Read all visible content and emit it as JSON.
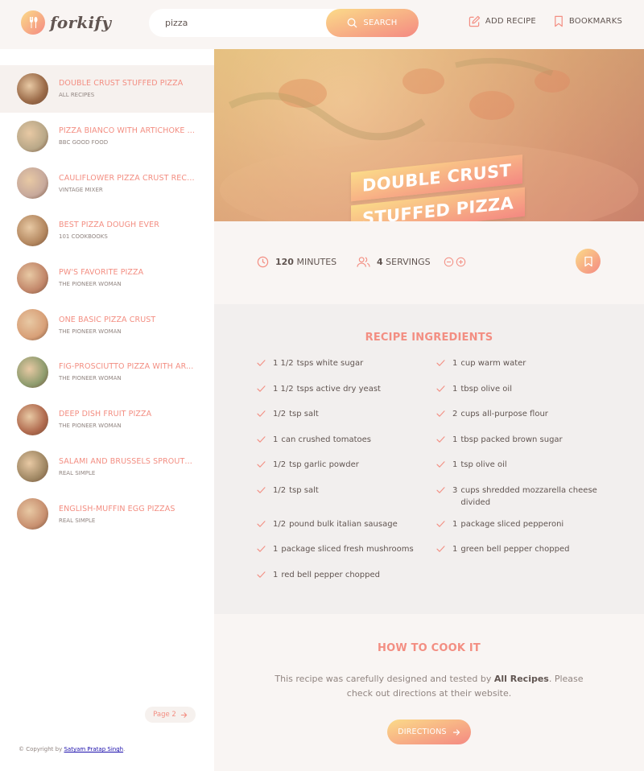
{
  "header": {
    "logo_text": "forkify",
    "search_value": "pizza",
    "search_button": "SEARCH",
    "nav": {
      "add_recipe": "ADD RECIPE",
      "bookmarks": "BOOKMARKS"
    }
  },
  "sidebar": {
    "results": [
      {
        "title": "DOUBLE CRUST STUFFED PIZZA",
        "publisher": "ALL RECIPES",
        "active": true,
        "thumb_color": "#9a6a48"
      },
      {
        "title": "PIZZA BIANCO WITH ARTICHOKE ...",
        "publisher": "BBC GOOD FOOD",
        "active": false,
        "thumb_color": "#b9a888"
      },
      {
        "title": "CAULIFLOWER PIZZA CRUST RECI...",
        "publisher": "VINTAGE MIXER",
        "active": false,
        "thumb_color": "#c7a99c"
      },
      {
        "title": "BEST PIZZA DOUGH EVER",
        "publisher": "101 COOKBOOKS",
        "active": false,
        "thumb_color": "#b48860"
      },
      {
        "title": "PW'S FAVORITE PIZZA",
        "publisher": "THE PIONEER WOMAN",
        "active": false,
        "thumb_color": "#c2876a"
      },
      {
        "title": "ONE BASIC PIZZA CRUST",
        "publisher": "THE PIONEER WOMAN",
        "active": false,
        "thumb_color": "#d8a078"
      },
      {
        "title": "FIG-PROSCIUTTO PIZZA WITH AR...",
        "publisher": "THE PIONEER WOMAN",
        "active": false,
        "thumb_color": "#8e9c6e"
      },
      {
        "title": "DEEP DISH FRUIT PIZZA",
        "publisher": "THE PIONEER WOMAN",
        "active": false,
        "thumb_color": "#b06a4e"
      },
      {
        "title": "SALAMI AND BRUSSELS SPROUTS...",
        "publisher": "REAL SIMPLE",
        "active": false,
        "thumb_color": "#a08864"
      },
      {
        "title": "ENGLISH-MUFFIN EGG PIZZAS",
        "publisher": "REAL SIMPLE",
        "active": false,
        "thumb_color": "#c89070"
      }
    ],
    "pagination": {
      "next_label": "Page 2"
    },
    "copyright": {
      "prefix": "© Copyright by ",
      "author": "Satyam Pratap Singh",
      "suffix": "."
    }
  },
  "recipe": {
    "title_line1": "DOUBLE CRUST",
    "title_line2": "STUFFED PIZZA",
    "cooking_time": "120",
    "cooking_time_unit": "MINUTES",
    "servings": "4",
    "servings_unit": "SERVINGS",
    "ingredients_heading": "RECIPE INGREDIENTS",
    "ingredients": [
      {
        "qty": "1 1/2",
        "desc": "tsps white sugar"
      },
      {
        "qty": "1",
        "desc": "cup warm water"
      },
      {
        "qty": "1 1/2",
        "desc": "tsps active dry yeast"
      },
      {
        "qty": "1",
        "desc": "tbsp olive oil"
      },
      {
        "qty": "1/2",
        "desc": "tsp salt"
      },
      {
        "qty": "2",
        "desc": "cups all-purpose flour"
      },
      {
        "qty": "1",
        "desc": "can crushed tomatoes"
      },
      {
        "qty": "1",
        "desc": "tbsp packed brown sugar"
      },
      {
        "qty": "1/2",
        "desc": "tsp garlic powder"
      },
      {
        "qty": "1",
        "desc": "tsp olive oil"
      },
      {
        "qty": "1/2",
        "desc": "tsp salt"
      },
      {
        "qty": "3",
        "desc": "cups shredded mozzarella cheese divided"
      },
      {
        "qty": "1/2",
        "desc": "pound bulk italian sausage"
      },
      {
        "qty": "1",
        "desc": "package sliced pepperoni"
      },
      {
        "qty": "1",
        "desc": "package sliced fresh mushrooms"
      },
      {
        "qty": "1",
        "desc": "green bell pepper chopped"
      },
      {
        "qty": "1",
        "desc": "red bell pepper chopped"
      }
    ],
    "how_heading": "HOW TO COOK IT",
    "how_text_1": "This recipe was carefully designed and tested by ",
    "how_publisher": "All Recipes",
    "how_text_2": ". Please check out directions at their website.",
    "directions_button": "DIRECTIONS"
  },
  "colors": {
    "accent_start": "#fbdb89",
    "accent_end": "#f48982",
    "title_text": "#f38e82"
  }
}
